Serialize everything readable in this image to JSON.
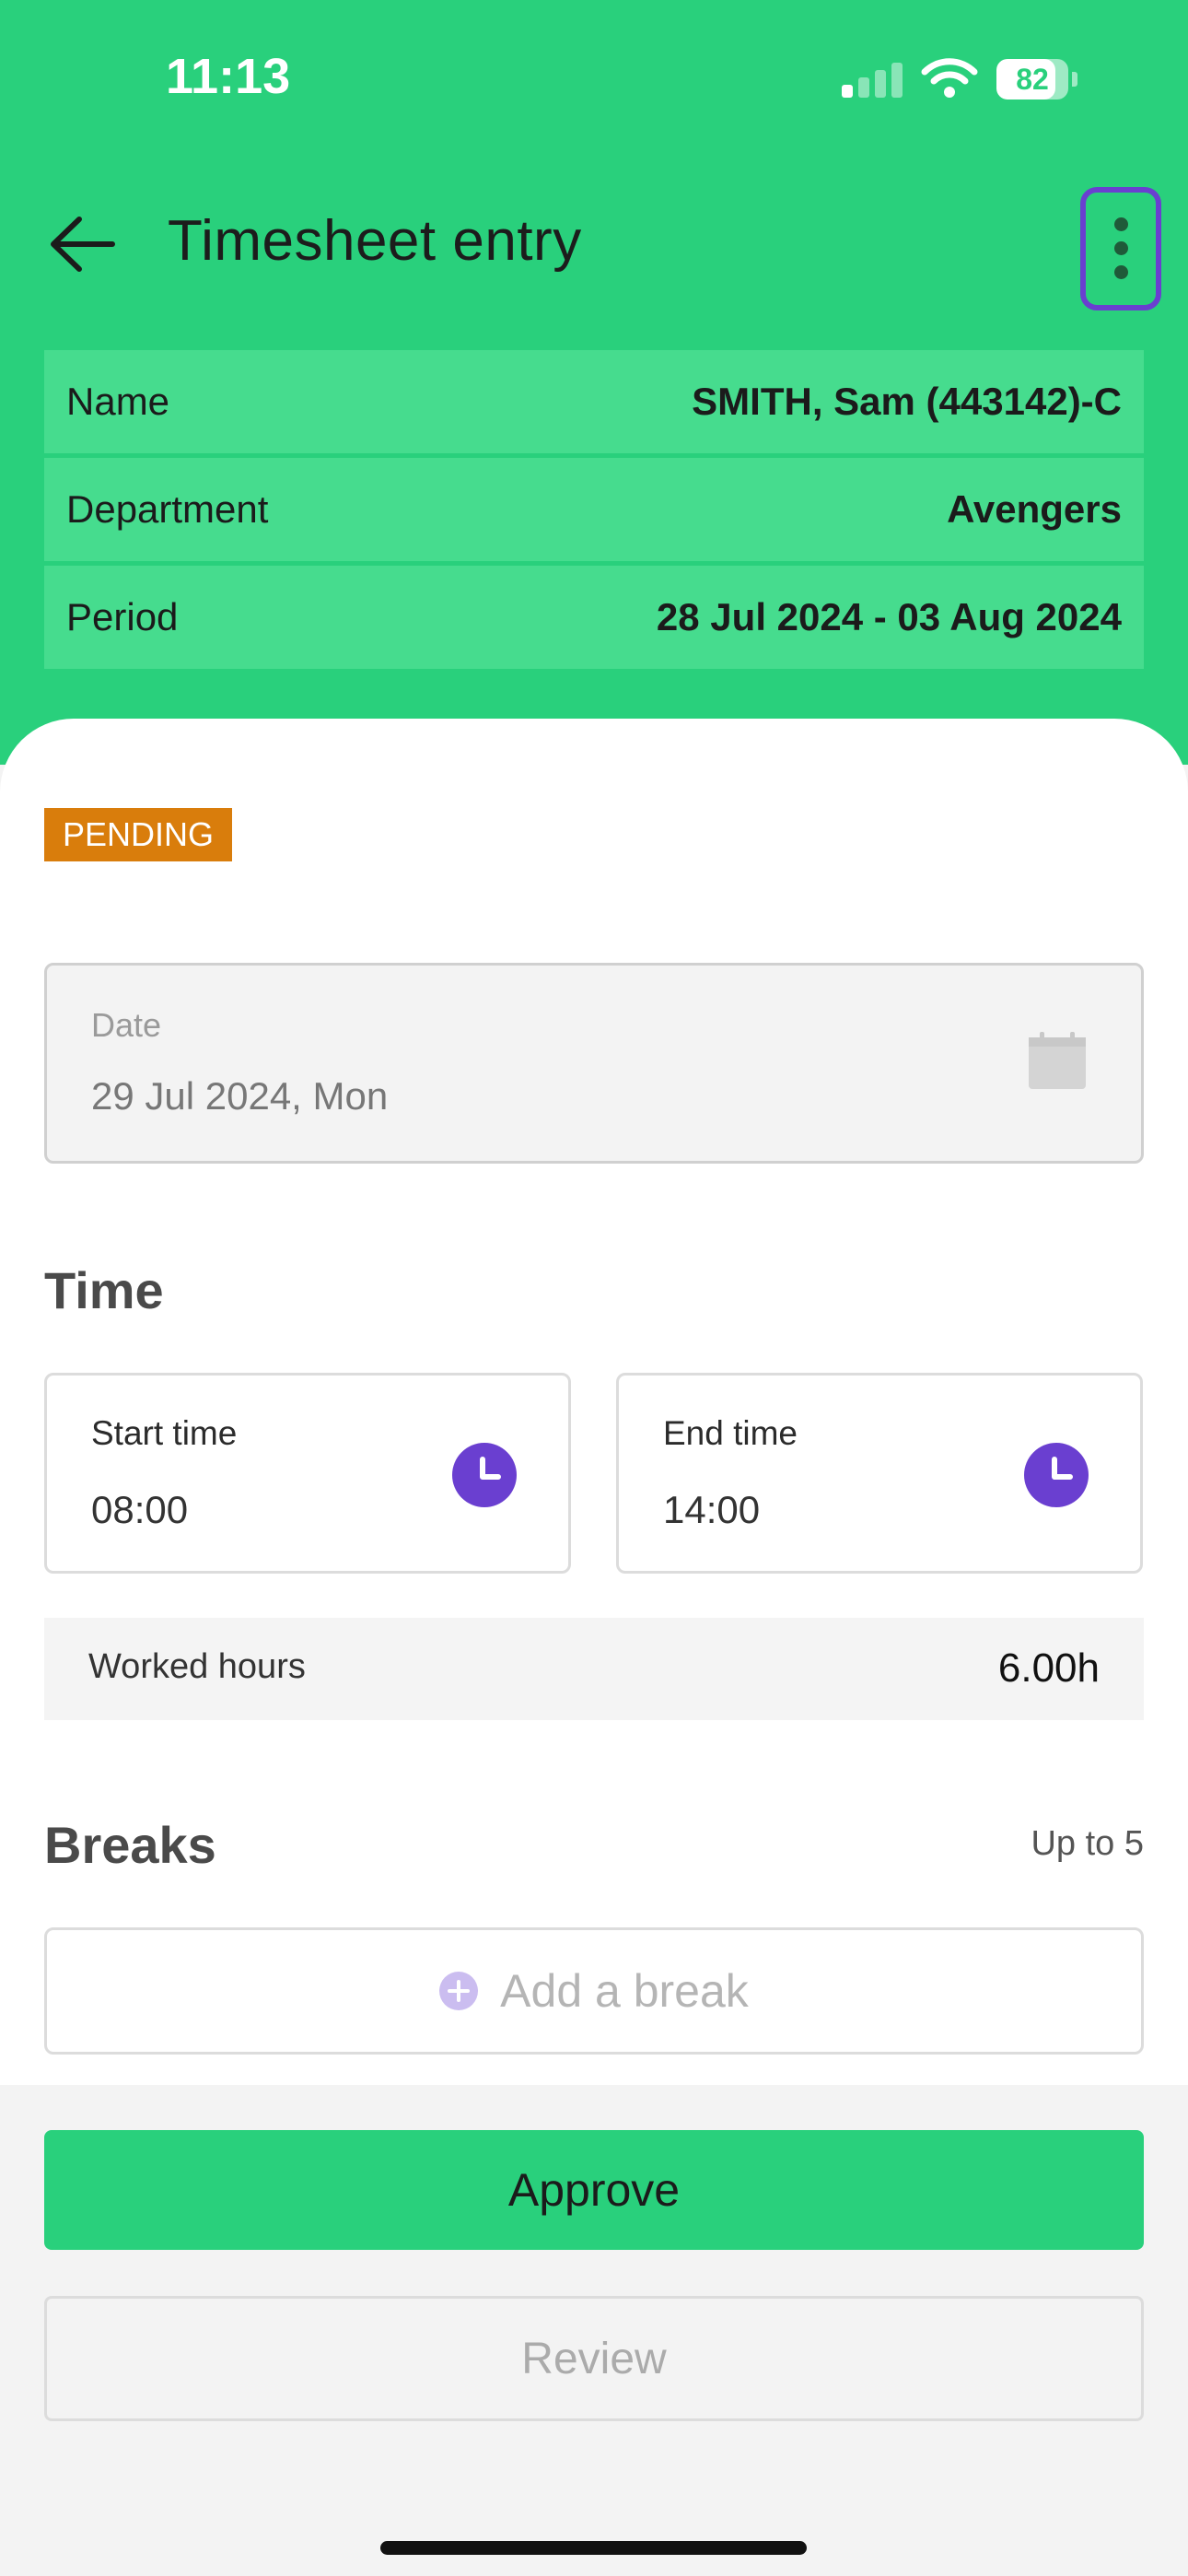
{
  "status_bar": {
    "time": "11:13",
    "battery": "82",
    "battery_level": 0.82
  },
  "header": {
    "title": "Timesheet entry"
  },
  "info": [
    {
      "label": "Name",
      "value": "SMITH, Sam (443142)-C"
    },
    {
      "label": "Department",
      "value": "Avengers"
    },
    {
      "label": "Period",
      "value": "28 Jul 2024 - 03 Aug 2024"
    }
  ],
  "status_badge": "PENDING",
  "date_field": {
    "label": "Date",
    "value": "29 Jul 2024, Mon"
  },
  "time_section": {
    "title": "Time",
    "start": {
      "label": "Start time",
      "value": "08:00"
    },
    "end": {
      "label": "End time",
      "value": "14:00"
    },
    "worked": {
      "label": "Worked hours",
      "value": "6.00h"
    }
  },
  "breaks_section": {
    "title": "Breaks",
    "limit": "Up to 5",
    "add_label": "Add a break"
  },
  "actions": {
    "approve": "Approve",
    "review": "Review"
  },
  "colors": {
    "brand_green": "#29d07c",
    "row_green": "#46dc8e",
    "accent_purple": "#6a3fd0",
    "pending_orange": "#d97d0c"
  },
  "icons": [
    "arrow-left-icon",
    "more-vertical-icon",
    "calendar-icon",
    "clock-icon",
    "plus-circle-icon",
    "wifi-icon",
    "signal-icon",
    "battery-icon"
  ]
}
